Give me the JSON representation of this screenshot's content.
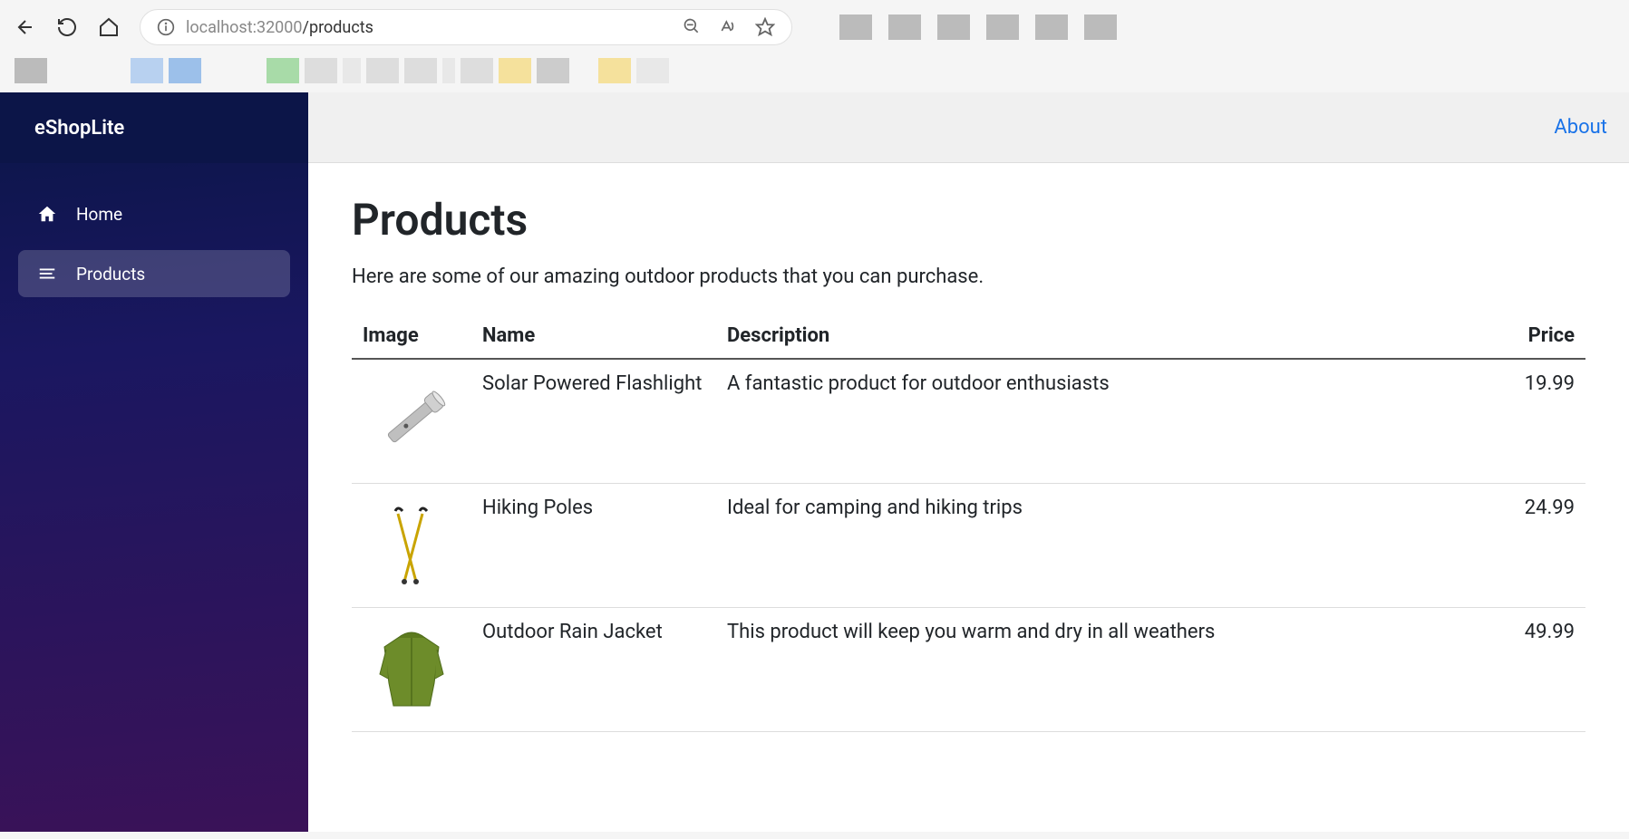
{
  "browser": {
    "url_host": "localhost",
    "url_port": ":32000",
    "url_path": "/products"
  },
  "sidebar": {
    "brand": "eShopLite",
    "items": [
      {
        "label": "Home",
        "icon": "home-icon",
        "active": false
      },
      {
        "label": "Products",
        "icon": "menu-icon",
        "active": true
      }
    ]
  },
  "header": {
    "about_label": "About"
  },
  "page": {
    "title": "Products",
    "subtitle": "Here are some of our amazing outdoor products that you can purchase."
  },
  "table": {
    "columns": {
      "image": "Image",
      "name": "Name",
      "description": "Description",
      "price": "Price"
    },
    "rows": [
      {
        "name": "Solar Powered Flashlight",
        "description": "A fantastic product for outdoor enthusiasts",
        "price": "19.99",
        "image_icon": "flashlight"
      },
      {
        "name": "Hiking Poles",
        "description": "Ideal for camping and hiking trips",
        "price": "24.99",
        "image_icon": "poles"
      },
      {
        "name": "Outdoor Rain Jacket",
        "description": "This product will keep you warm and dry in all weathers",
        "price": "49.99",
        "image_icon": "jacket"
      }
    ]
  }
}
